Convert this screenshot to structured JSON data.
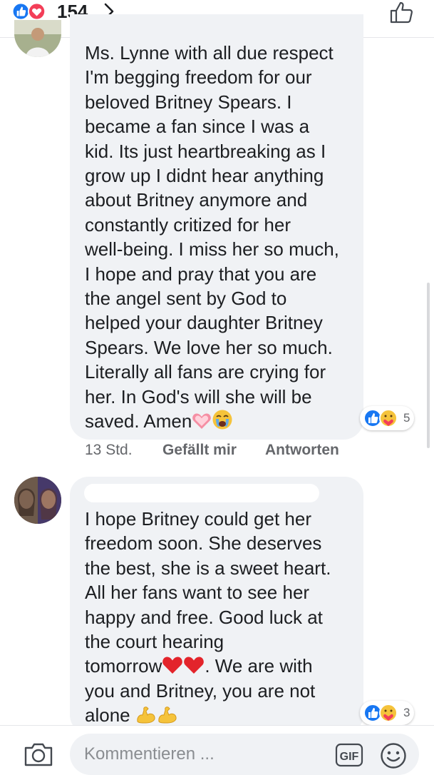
{
  "reactions": {
    "count": "154",
    "icons": [
      "like-icon",
      "love-icon"
    ]
  },
  "comments": [
    {
      "text": "Ms. Lynne with all due respect\nI'm begging freedom for our\nbeloved Britney Spears. I\nbecame a fan since I was a\nkid. Its just heartbreaking as I\ngrow up I didnt hear anything\nabout Britney anymore and\nconstantly critized for her\nwell-being. I miss her so much,\nI hope and pray that you are\nthe angel sent by God to\nhelped your daughter Britney\nSpears. We love her so much.\nLiterally all fans are crying for\nher. In God's will she will be\nsaved. Amen",
      "trailing_emoji": [
        "heart-icon",
        "crying-face-icon"
      ],
      "reactions": {
        "count": "5",
        "icons": [
          "like-icon",
          "care-icon"
        ]
      },
      "time": "13 Std.",
      "like_label": "Gefällt mir",
      "reply_label": "Antworten"
    },
    {
      "text_a": "I hope Britney could get her\nfreedom soon. She deserves\nthe best, she is a sweet heart.\nAll her fans want to see her\nhappy and free. Good luck at\nthe court hearing\ntomorrow",
      "text_b": ". We are with\nyou and Britney, you are not\nalone",
      "mid_emoji": [
        "red-heart-icon",
        "red-heart-icon"
      ],
      "trailing_emoji": [
        "flexed-biceps-icon",
        "flexed-biceps-icon"
      ],
      "reactions": {
        "count": "3",
        "icons": [
          "like-icon",
          "care-icon"
        ]
      }
    }
  ],
  "composer": {
    "placeholder": "Kommentieren ..."
  },
  "colors": {
    "bubble": "#f0f2f5",
    "like_blue": "#1877f2",
    "love_red": "#f33e58",
    "meta_gray": "#65676b"
  }
}
